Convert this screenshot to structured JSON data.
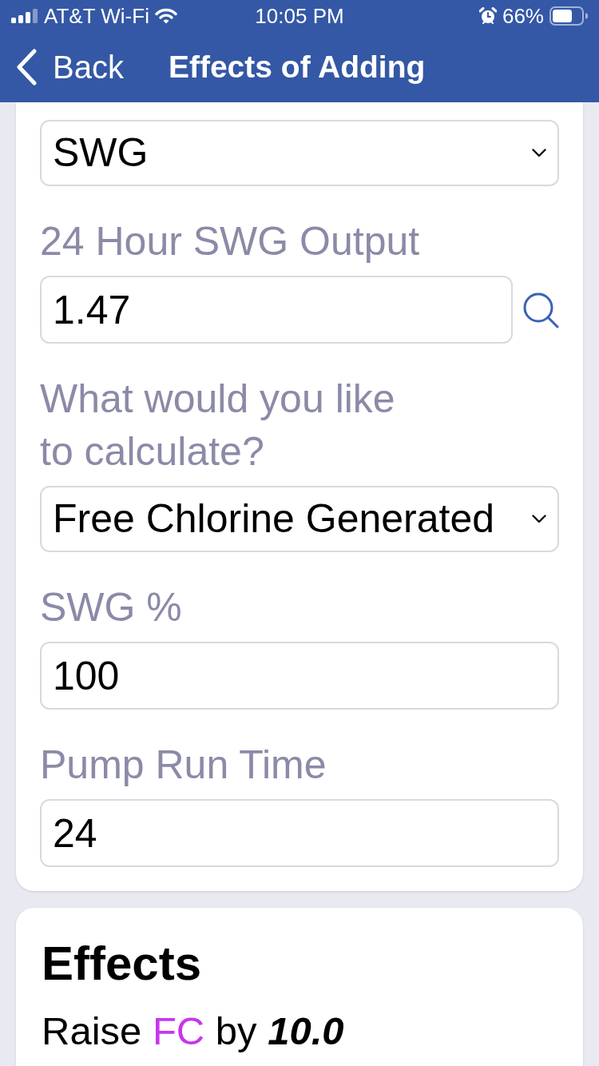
{
  "status_bar": {
    "carrier": "AT&T Wi-Fi",
    "time": "10:05 PM",
    "battery": "66%"
  },
  "nav": {
    "back": "Back",
    "title": "Effects of Adding"
  },
  "fields": [
    {
      "kind": "select",
      "value": "SWG"
    },
    {
      "kind": "input",
      "label": "24 Hour SWG Output",
      "value": "1.47",
      "lookup": true
    },
    {
      "kind": "select",
      "label": "What would you like\nto calculate?",
      "value": "Free Chlorine Generated"
    },
    {
      "kind": "input",
      "label": "SWG %",
      "value": "100",
      "lookup": false
    },
    {
      "kind": "input",
      "label": "Pump Run Time",
      "value": "24",
      "lookup": false
    }
  ],
  "effects": {
    "title": "Effects",
    "items": [
      {
        "verb": "Raise",
        "chemical": "FC",
        "color": "#c935ef",
        "joiner": "by",
        "amount": "10.0"
      }
    ]
  }
}
